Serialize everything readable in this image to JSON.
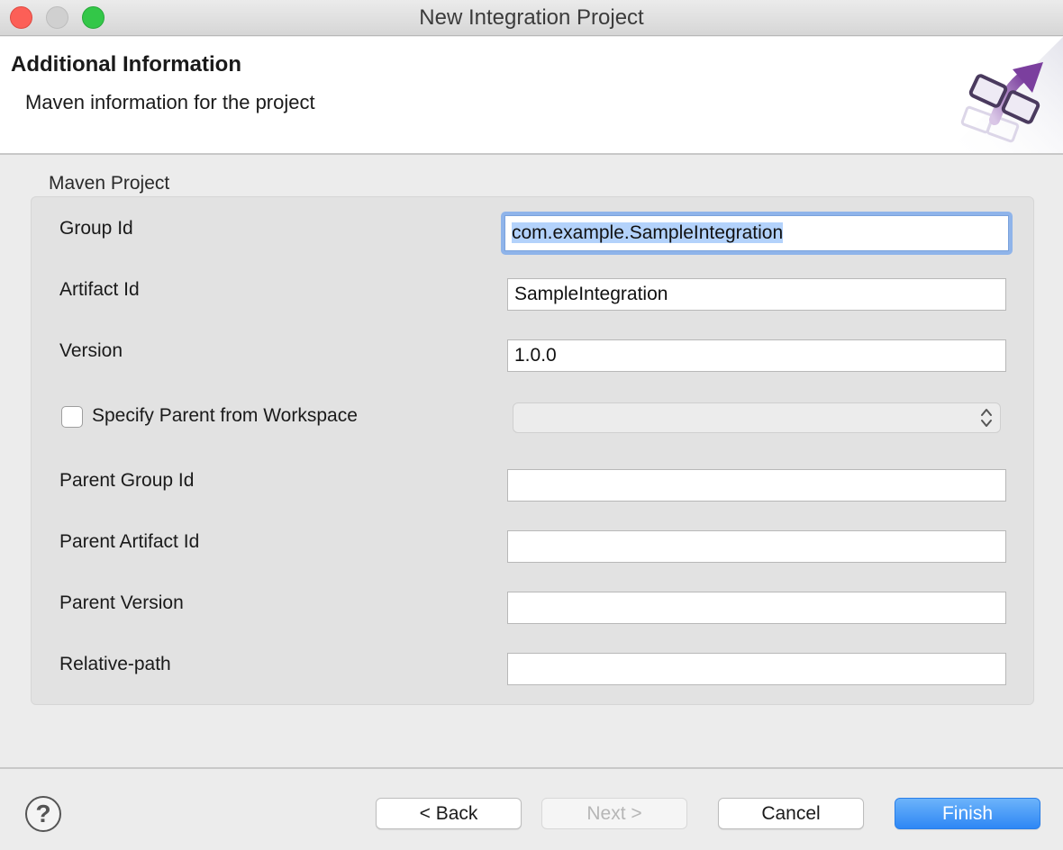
{
  "window": {
    "title": "New Integration Project"
  },
  "banner": {
    "title": "Additional Information",
    "subtitle": "Maven information for the project"
  },
  "group": {
    "label": "Maven Project"
  },
  "fields": {
    "group_id": {
      "label": "Group Id",
      "value": "com.example.SampleIntegration"
    },
    "artifact_id": {
      "label": "Artifact Id",
      "value": "SampleIntegration"
    },
    "version": {
      "label": "Version",
      "value": "1.0.0"
    },
    "specify_parent": {
      "label": "Specify Parent from Workspace",
      "checked": false,
      "selected": ""
    },
    "parent_group_id": {
      "label": "Parent Group Id",
      "value": ""
    },
    "parent_artifact_id": {
      "label": "Parent Artifact Id",
      "value": ""
    },
    "parent_version": {
      "label": "Parent Version",
      "value": ""
    },
    "relative_path": {
      "label": "Relative-path",
      "value": ""
    }
  },
  "buttons": {
    "help": "?",
    "back": "< Back",
    "next": "Next >",
    "cancel": "Cancel",
    "finish": "Finish"
  },
  "colors": {
    "accent": "#2e87f5",
    "focus": "#8fb4ea",
    "selection": "#b3d2fb",
    "graphic_purple": "#7b3f9e"
  },
  "icons": {
    "wizard_graphic": "integration-wizard-icon",
    "help": "question-circle-icon",
    "select_arrows": "up-down-chevron-icon"
  }
}
